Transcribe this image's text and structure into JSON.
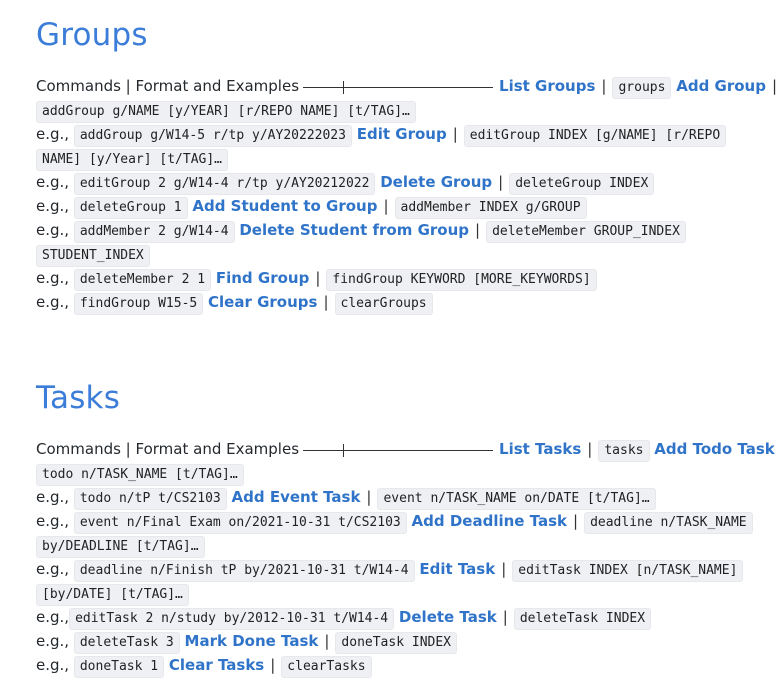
{
  "groups": {
    "title": "Groups",
    "header_lead": "Commands | Format and Examples",
    "list_label": "List Groups",
    "list_code": "groups",
    "add_label": "Add Group",
    "add_format": "addGroup g/NAME [y/YEAR] [r/REPO NAME] [t/TAG]…",
    "eg": "e.g.,",
    "add_example": "addGroup g/W14-5 r/tp y/AY20222023",
    "edit_label": "Edit Group",
    "edit_format_1": "editGroup INDEX [g/NAME] [r/REPO",
    "edit_format_2": "NAME] [y/Year] [t/TAG]…",
    "edit_example": "editGroup 2 g/W14-4 r/tp y/AY20212022",
    "delete_label": "Delete Group",
    "delete_format": "deleteGroup INDEX",
    "delete_example": "deleteGroup 1",
    "addmember_label": "Add Student to Group",
    "addmember_format": "addMember INDEX g/GROUP",
    "addmember_example": "addMember 2 g/W14-4",
    "deletemember_label": "Delete Student from Group",
    "deletemember_format_1": "deleteMember GROUP_INDEX",
    "deletemember_format_2": "STUDENT_INDEX",
    "deletemember_example": "deleteMember 2 1",
    "find_label": "Find Group",
    "find_format": "findGroup KEYWORD [MORE_KEYWORDS]",
    "find_example": "findGroup W15-5",
    "clear_label": "Clear Groups",
    "clear_format": "clearGroups"
  },
  "tasks": {
    "title": "Tasks",
    "header_lead": "Commands | Format and Examples",
    "list_label": "List Tasks",
    "list_code": "tasks",
    "todo_label": "Add Todo Task",
    "todo_format": "todo n/TASK_NAME [t/TAG]…",
    "eg": "e.g.,",
    "todo_example": "todo n/tP t/CS2103",
    "event_label": "Add Event Task",
    "event_format": "event n/TASK_NAME on/DATE [t/TAG]…",
    "event_example": "event n/Final Exam on/2021-10-31 t/CS2103",
    "deadline_label": "Add Deadline Task",
    "deadline_format_1": "deadline n/TASK_NAME",
    "deadline_format_2": "by/DEADLINE [t/TAG]…",
    "deadline_example": "deadline n/Finish tP by/2021-10-31 t/W14-4",
    "edit_label": "Edit Task",
    "edit_format_1": "editTask INDEX [n/TASK_NAME]",
    "edit_format_2": "[by/DATE] [t/TAG]…",
    "edit_example": "editTask 2 n/study by/2012-10-31 t/W14-4",
    "delete_label": "Delete Task",
    "delete_format": "deleteTask INDEX",
    "delete_example": "deleteTask 3",
    "done_label": "Mark Done Task",
    "done_format": "doneTask INDEX",
    "done_example": "doneTask 1",
    "clear_label": "Clear Tasks",
    "clear_format": "clearTasks"
  },
  "colors": {
    "heading": "#3b7dd8",
    "link": "#2f74c8",
    "code_bg": "#eef0f4",
    "text": "#24292e"
  }
}
